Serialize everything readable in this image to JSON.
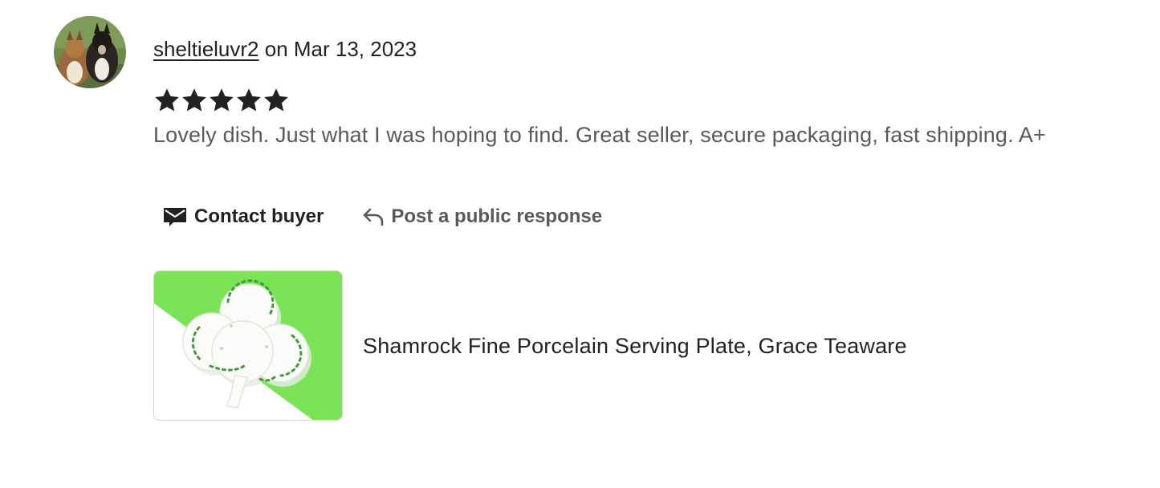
{
  "review": {
    "reviewer_name": "sheltieluvr2",
    "date_text": " on Mar 13, 2023",
    "rating": 5,
    "rating_max": 5,
    "text": "Lovely dish. Just what I was hoping to find. Great seller, secure packaging, fast shipping. A+"
  },
  "actions": {
    "contact_label": "Contact buyer",
    "contact_icon": "envelope-icon",
    "respond_label": "Post a public response",
    "respond_icon": "reply-arrow-icon"
  },
  "listing": {
    "title": "Shamrock Fine Porcelain Serving Plate, Grace Teaware",
    "thumb_bg_color": "#7be356"
  },
  "colors": {
    "text_primary": "#222222",
    "text_secondary": "#595959",
    "star": "#222222"
  }
}
